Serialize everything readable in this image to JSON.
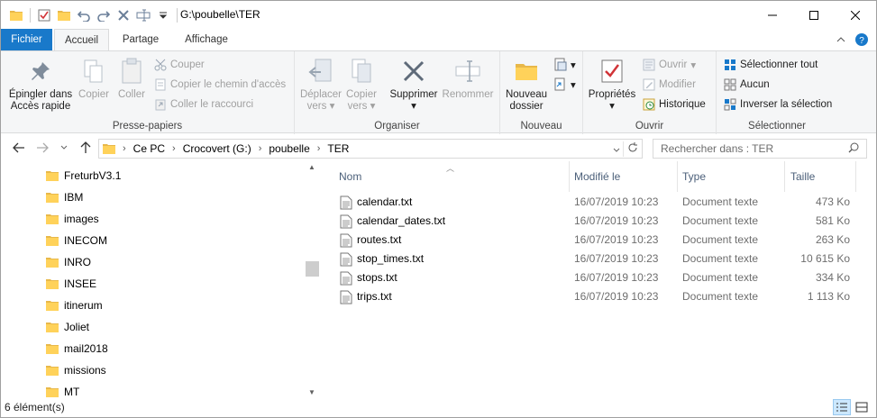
{
  "title_bar": {
    "path": "G:\\poubelle\\TER"
  },
  "ribbon_tabs": [
    {
      "label": "Fichier"
    },
    {
      "label": "Accueil"
    },
    {
      "label": "Partage"
    },
    {
      "label": "Affichage"
    }
  ],
  "ribbon": {
    "clipboard": {
      "group_label": "Presse-papiers",
      "pin_line1": "Épingler dans",
      "pin_line2": "Accès rapide",
      "copy": "Copier",
      "paste": "Coller",
      "cut": "Couper",
      "copy_path": "Copier le chemin d'accès",
      "paste_shortcut": "Coller le raccourci"
    },
    "organize": {
      "group_label": "Organiser",
      "move_line1": "Déplacer",
      "move_line2": "vers",
      "copyto_line1": "Copier",
      "copyto_line2": "vers",
      "delete": "Supprimer",
      "rename": "Renommer"
    },
    "new": {
      "group_label": "Nouveau",
      "new_folder_line1": "Nouveau",
      "new_folder_line2": "dossier"
    },
    "open": {
      "group_label": "Ouvrir",
      "properties": "Propriétés",
      "open": "Ouvrir",
      "edit": "Modifier",
      "history": "Historique"
    },
    "select": {
      "group_label": "Sélectionner",
      "select_all": "Sélectionner tout",
      "select_none": "Aucun",
      "invert": "Inverser la sélection"
    }
  },
  "address": {
    "crumbs": [
      "Ce PC",
      "Crocovert (G:)",
      "poubelle",
      "TER"
    ],
    "search_placeholder": "Rechercher dans : TER"
  },
  "nav_pane": {
    "folders": [
      "FreturbV3.1",
      "IBM",
      "images",
      "INECOM",
      "INRO",
      "INSEE",
      "itinerum",
      "Joliet",
      "mail2018",
      "missions",
      "MT"
    ]
  },
  "file_list": {
    "columns": {
      "name": "Nom",
      "modified": "Modifié le",
      "type": "Type",
      "size": "Taille"
    },
    "files": [
      {
        "name": "calendar.txt",
        "modified": "16/07/2019 10:23",
        "type": "Document texte",
        "size": "473 Ko"
      },
      {
        "name": "calendar_dates.txt",
        "modified": "16/07/2019 10:23",
        "type": "Document texte",
        "size": "581 Ko"
      },
      {
        "name": "routes.txt",
        "modified": "16/07/2019 10:23",
        "type": "Document texte",
        "size": "263 Ko"
      },
      {
        "name": "stop_times.txt",
        "modified": "16/07/2019 10:23",
        "type": "Document texte",
        "size": "10 615 Ko"
      },
      {
        "name": "stops.txt",
        "modified": "16/07/2019 10:23",
        "type": "Document texte",
        "size": "334 Ko"
      },
      {
        "name": "trips.txt",
        "modified": "16/07/2019 10:23",
        "type": "Document texte",
        "size": "1 113 Ko"
      }
    ]
  },
  "status_bar": {
    "item_count": "6 élément(s)"
  },
  "colors": {
    "accent": "#1979ca",
    "folder": "#ffd25a",
    "delete_red": "#d13438"
  }
}
